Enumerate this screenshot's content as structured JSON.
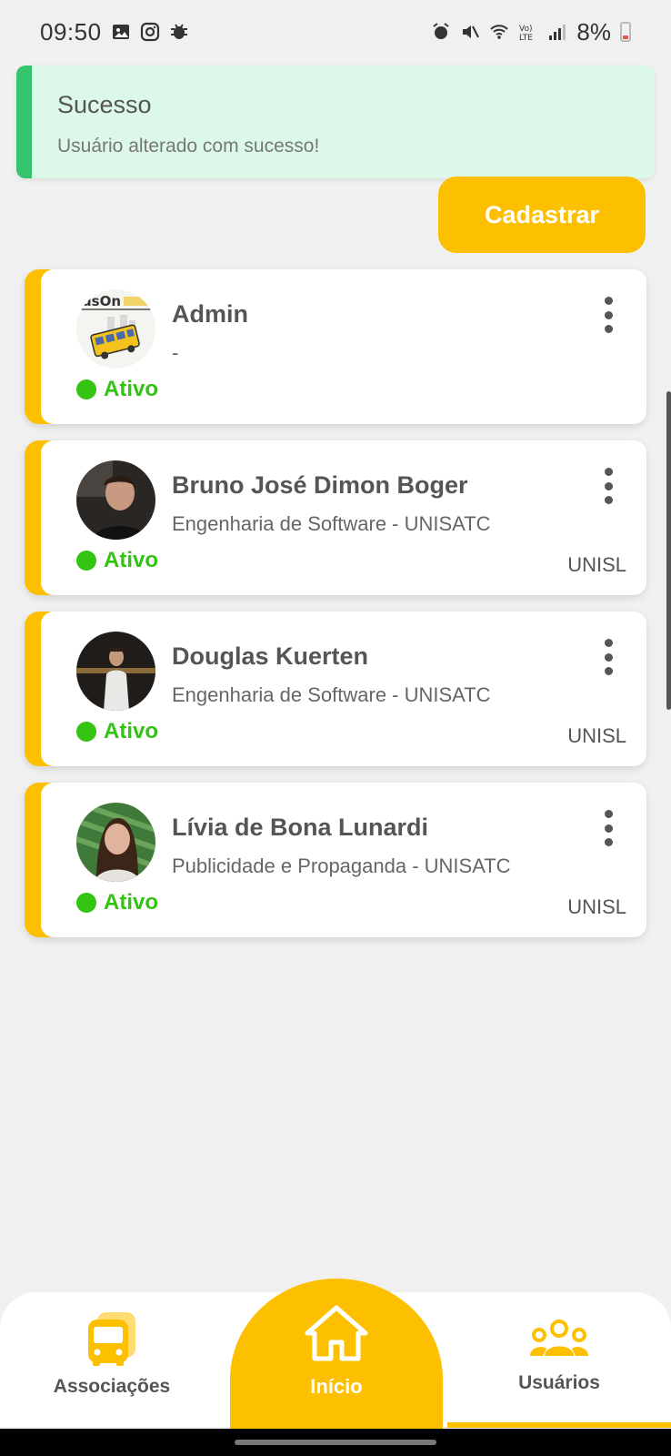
{
  "status_bar": {
    "time": "09:50",
    "battery": "8%"
  },
  "toast": {
    "title": "Sucesso",
    "message": "Usuário alterado com sucesso!",
    "accent": "#35c36b"
  },
  "actions": {
    "register_label": "Cadastrar"
  },
  "users": [
    {
      "name": "Admin",
      "subtitle": "-",
      "status": "Ativo",
      "institution": "",
      "avatar": "busone-logo"
    },
    {
      "name": "Bruno José Dimon Boger",
      "subtitle": "Engenharia de Software - UNISATC",
      "status": "Ativo",
      "institution": "UNISL",
      "avatar": "photo"
    },
    {
      "name": "Douglas Kuerten",
      "subtitle": "Engenharia de Software - UNISATC",
      "status": "Ativo",
      "institution": "UNISL",
      "avatar": "photo"
    },
    {
      "name": "Lívia de Bona Lunardi",
      "subtitle": "Publicidade e Propaganda - UNISATC",
      "status": "Ativo",
      "institution": "UNISL",
      "avatar": "photo"
    }
  ],
  "nav": {
    "associations": "Associações",
    "home": "Início",
    "users": "Usuários"
  },
  "colors": {
    "brand": "#fdc000",
    "active": "#33c313"
  }
}
